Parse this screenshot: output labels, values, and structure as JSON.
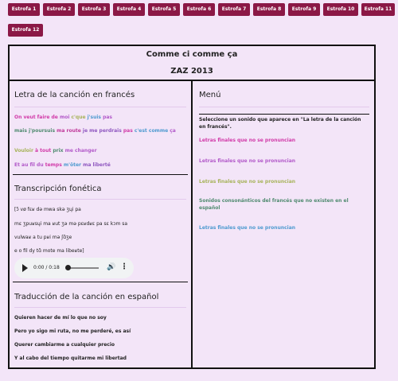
{
  "tabs": [
    "Estrofa 1",
    "Estrofa 2",
    "Estrofa 3",
    "Estrofa 4",
    "Estrofa 5",
    "Estrofa 6",
    "Estrofa 7",
    "Estrofa 8",
    "Estrofa 9",
    "Estrofa 10",
    "Estrofa 11",
    "Estrofa 12"
  ],
  "header": {
    "title": "Comme ci comme ça",
    "subtitle": "ZAZ 2013"
  },
  "lyrics": {
    "heading": "Letra de la canción en francés",
    "lines": [
      [
        {
          "t": "On veut faire de ",
          "c": "#d13aa8"
        },
        {
          "t": "moi ",
          "c": "#b259c9"
        },
        {
          "t": "c'que ",
          "c": "#a7b35a"
        },
        {
          "t": "j'suis ",
          "c": "#4e9ad0"
        },
        {
          "t": "pas",
          "c": "#b259c9"
        }
      ],
      [
        {
          "t": "mais j'poursuis ",
          "c": "#4f8a6f"
        },
        {
          "t": "ma route ",
          "c": "#c0399a"
        },
        {
          "t": "je me perdrais ",
          "c": "#8f57c0"
        },
        {
          "t": "pas ",
          "c": "#d13aa8"
        },
        {
          "t": "c'est comme ",
          "c": "#4e9ad0"
        },
        {
          "t": "ça",
          "c": "#b259c9"
        }
      ],
      [
        {
          "t": "Vouloir ",
          "c": "#a7b35a"
        },
        {
          "t": "à tout ",
          "c": "#d13aa8"
        },
        {
          "t": "prix ",
          "c": "#4f8a6f"
        },
        {
          "t": "me changer",
          "c": "#b259c9"
        }
      ],
      [
        {
          "t": "Et au fil du ",
          "c": "#b259c9"
        },
        {
          "t": "temps ",
          "c": "#d13aa8"
        },
        {
          "t": "m'ôter ",
          "c": "#4e9ad0"
        },
        {
          "t": "ma liberté",
          "c": "#8f57c0"
        }
      ]
    ]
  },
  "phonetic": {
    "heading": "Transcripción fonética",
    "lines": [
      "[ɔ̃ vø fɛʁ də mwa skə ʒɥi pa",
      "mɛ ʒpuʁsɥi ma ʁut ʒə mə pɛʁdʁɛ pa sɛ kɔm sa",
      "vulwaʁ a tu pʁi mə ʃɑ̃ʒe",
      "e o fil dy tɑ̃ mote ma libeʁte]"
    ],
    "audio": {
      "time": "0:00 / 0:18"
    }
  },
  "translation": {
    "heading": "Traducción de la canción en español",
    "lines": [
      "Quieren hacer de mí lo que no soy",
      "Pero yo sigo mi ruta, no me perderé, es así",
      "Querer cambiarme a cualquier precio",
      "Y al cabo del tiempo quitarme mi libertad"
    ]
  },
  "menu": {
    "heading": "Menú",
    "intro": "Seleccione un sonido que aparece en \"La letra de la canción en francés\".",
    "items": [
      {
        "label": "Letras finales que no se pronuncian",
        "color": "#d13aa8"
      },
      {
        "label": "Letras finales que no se pronuncian",
        "color": "#b259c9"
      },
      {
        "label": "Letras finales que no se pronuncian",
        "color": "#a7b35a"
      },
      {
        "label": "Sonidos consonánticos del francés que no existen en el español",
        "color": "#4f8a6f"
      },
      {
        "label": "Letras finales que no se pronuncian",
        "color": "#4e9ad0"
      }
    ]
  },
  "colors": {
    "tab_bg": "#8b1846",
    "page_bg": "#f3e5f8"
  }
}
